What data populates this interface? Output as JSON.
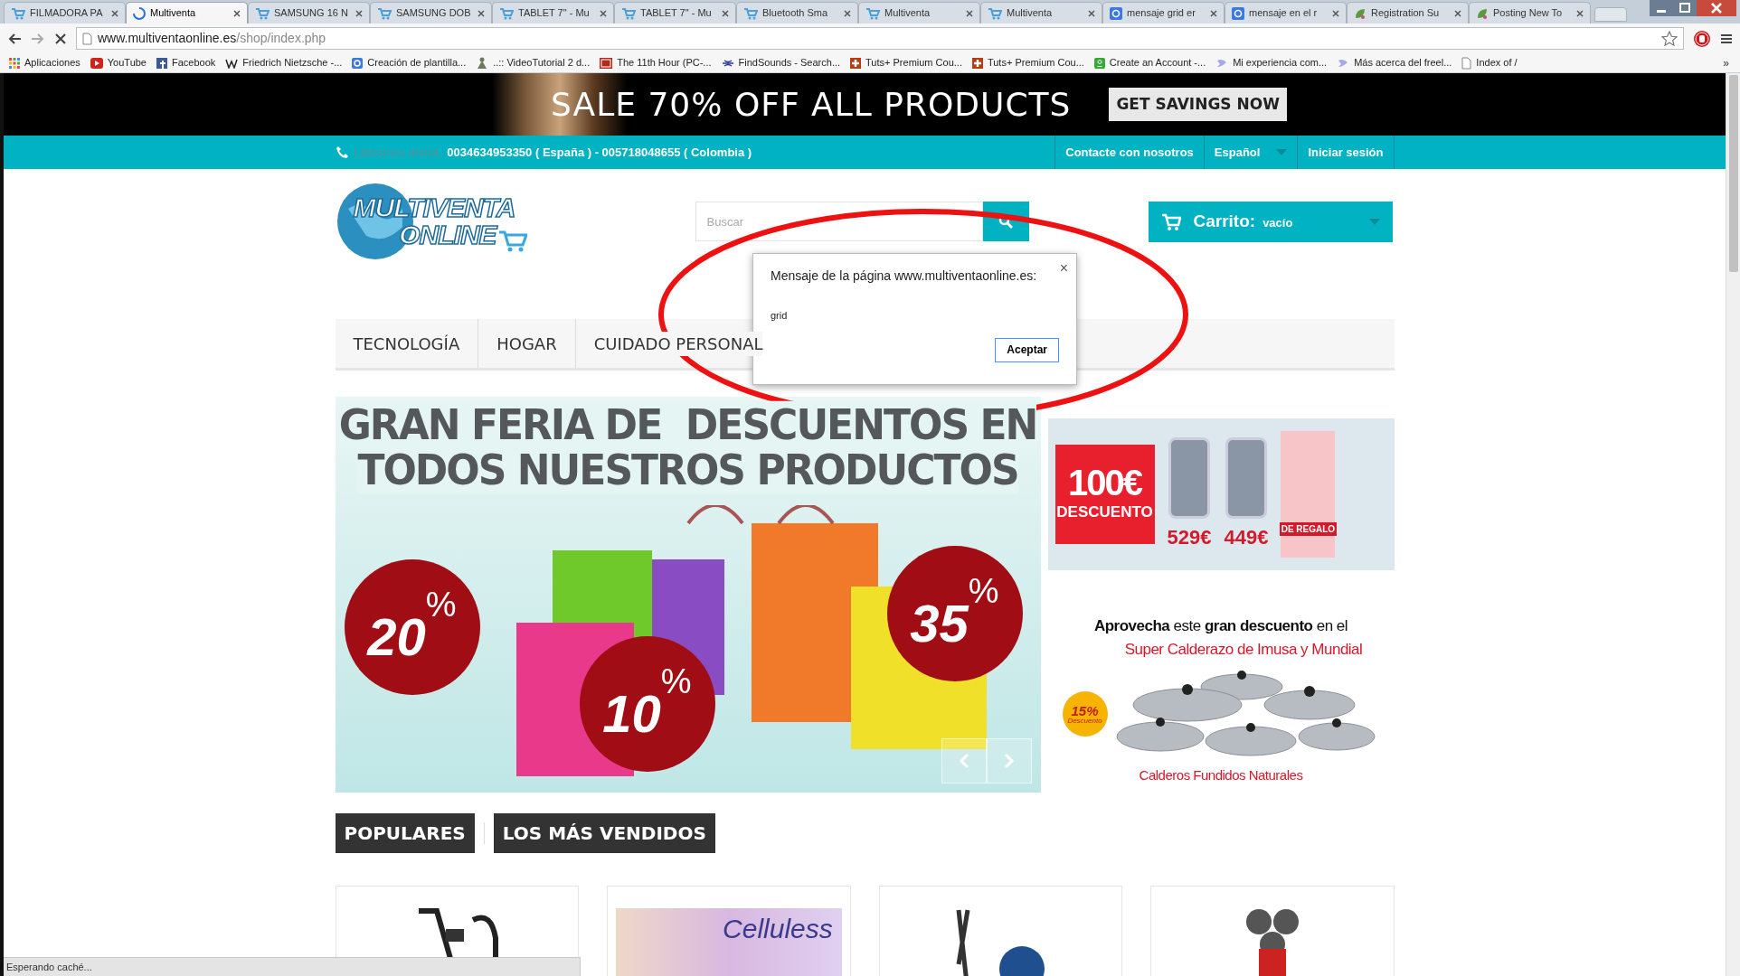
{
  "browser": {
    "tabs": [
      {
        "title": "FILMADORA PA",
        "kind": "cart",
        "selected": false,
        "loading": false
      },
      {
        "title": "Multiventa",
        "selected": true,
        "loading": true
      },
      {
        "title": "SAMSUNG 16 N",
        "kind": "cart",
        "selected": false,
        "loading": false
      },
      {
        "title": "SAMSUNG DOB",
        "kind": "cart",
        "selected": false,
        "loading": false
      },
      {
        "title": "TABLET 7\" - Mu",
        "kind": "cart",
        "selected": false,
        "loading": false
      },
      {
        "title": "TABLET 7\" - Mu",
        "kind": "cart",
        "selected": false,
        "loading": false
      },
      {
        "title": "Bluetooth Sma",
        "kind": "cart",
        "selected": false,
        "loading": false
      },
      {
        "title": "Multiventa",
        "kind": "cart",
        "selected": false,
        "loading": false
      },
      {
        "title": "Multiventa",
        "kind": "cart",
        "selected": false,
        "loading": false
      },
      {
        "title": "mensaje grid er",
        "kind": "google",
        "selected": false,
        "loading": false
      },
      {
        "title": "mensaje en el r",
        "kind": "google",
        "selected": false,
        "loading": false
      },
      {
        "title": "Registration Su",
        "kind": "leaf",
        "selected": false,
        "loading": false
      },
      {
        "title": "Posting New To",
        "kind": "leaf",
        "selected": false,
        "loading": false
      }
    ],
    "address": {
      "host": "www.multiventaonline.es",
      "path": "/shop/index.php"
    },
    "bookmarks": [
      {
        "label": "Aplicaciones",
        "kind": "apps"
      },
      {
        "label": "YouTube",
        "kind": "play"
      },
      {
        "label": "Facebook",
        "kind": "fb"
      },
      {
        "label": "Friedrich Nietzsche -...",
        "kind": "wiki"
      },
      {
        "label": "Creación de plantilla...",
        "kind": "google"
      },
      {
        "label": "..:: VideoTutorial 2 d...",
        "kind": "figure"
      },
      {
        "label": "The 11th Hour (PC-...",
        "kind": "tv"
      },
      {
        "label": "FindSounds - Search...",
        "kind": "wave"
      },
      {
        "label": "Tuts+ Premium Cou...",
        "kind": "plus"
      },
      {
        "label": "Tuts+ Premium Cou...",
        "kind": "plus"
      },
      {
        "label": "Create an Account -...",
        "kind": "odnok"
      },
      {
        "label": "Mi experiencia com...",
        "kind": "bubble"
      },
      {
        "label": "Más acerca del freel...",
        "kind": "bubble"
      },
      {
        "label": "Index of /",
        "kind": "page"
      }
    ],
    "bookmarks_more": "»"
  },
  "page": {
    "promo": {
      "text": "SALE 70% OFF ALL PRODUCTS",
      "button": "GET SAVINGS NOW"
    },
    "contact": {
      "label": "Llámanos ahora:",
      "phones": "0034634953350 ( España ) - 005718048655 ( Colombia )"
    },
    "top_links": [
      {
        "label": "Contacte con nosotros",
        "dropdown": false
      },
      {
        "label": "Español",
        "dropdown": true
      },
      {
        "label": "Iniciar sesión",
        "dropdown": false
      }
    ],
    "logo": {
      "line1": "MULTIVENTA",
      "line2": "ONLINE"
    },
    "search": {
      "placeholder": "Buscar"
    },
    "cart": {
      "label": "Carrito:",
      "value": "vacío"
    },
    "menu": [
      "TECNOLOGÍA",
      "HOGAR",
      "CUIDADO PERSONAL"
    ],
    "slider": {
      "headline": [
        "GRAN FERIA DE  DESCUENTOS EN",
        "TODOS NUESTROS PRODUCTOS"
      ],
      "badges": [
        {
          "number": "20",
          "sign": "%"
        },
        {
          "number": "10",
          "sign": "%"
        },
        {
          "number": "35",
          "sign": "%"
        }
      ]
    },
    "phone_banner": {
      "amount": "100€",
      "label": "DESCUENTO",
      "prices": [
        "529€",
        "449€"
      ],
      "gift": "DE REGALO"
    },
    "pots_banner": {
      "line1": "**Aprovecha** este **gran descuento** en el",
      "line2": "Super Calderazo de Imusa y Mundial",
      "badge": "15%",
      "badge_sub": "Descuento",
      "caption": "Calderos Fundidos Naturales"
    },
    "product_tabs": [
      "POPULARES",
      "LOS MÁS VENDIDOS"
    ],
    "products": [
      {
        "kind": "bike"
      },
      {
        "kind": "cream",
        "label": "Celluless"
      },
      {
        "kind": "elliptical"
      },
      {
        "kind": "shaver"
      }
    ]
  },
  "dialog": {
    "title": "Mensaje de la página www.multiventaonline.es:",
    "message": "grid",
    "button": "Aceptar",
    "close": "×"
  },
  "status_bar": "Esperando caché..."
}
